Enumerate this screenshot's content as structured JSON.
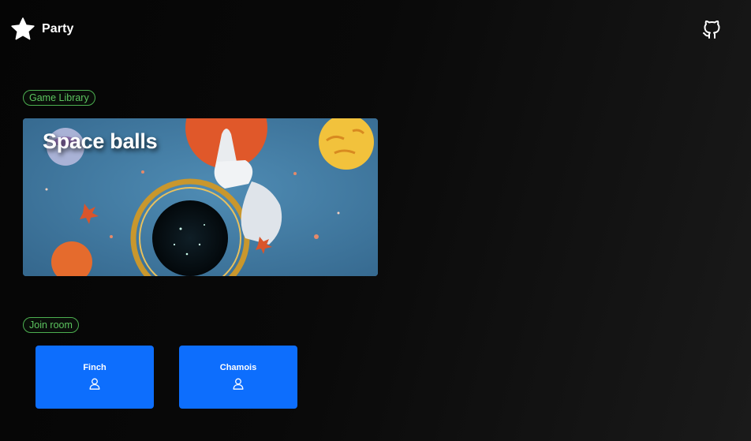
{
  "header": {
    "brand": "Party",
    "logo_icon": "star-icon",
    "github_icon": "github-icon"
  },
  "library": {
    "label": "Game Library",
    "games": [
      {
        "title": "Space balls"
      }
    ]
  },
  "join": {
    "label": "Join room",
    "rooms": [
      {
        "name": "Finch",
        "icon": "user-icon"
      },
      {
        "name": "Chamois",
        "icon": "user-icon"
      }
    ]
  },
  "colors": {
    "accent_green": "#4caf50",
    "room_blue": "#0d6efd",
    "background": "#0a0a0a"
  }
}
